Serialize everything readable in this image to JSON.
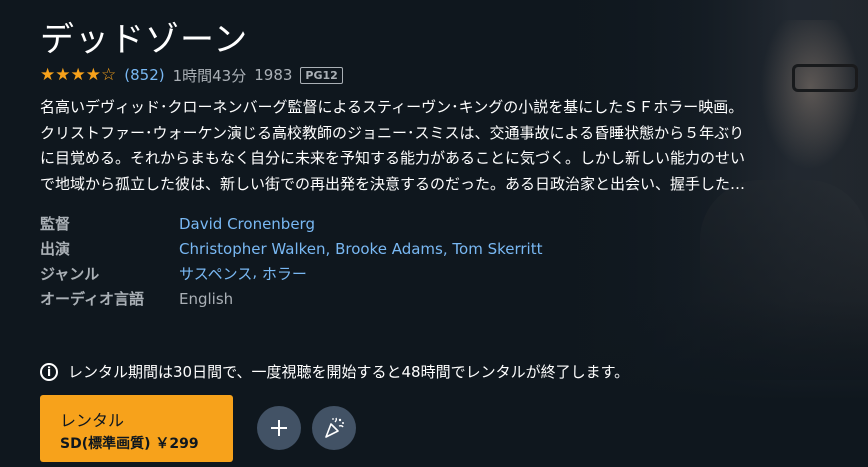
{
  "title": "デッドゾーン",
  "meta": {
    "rating_stars": 4,
    "rating_max": 5,
    "rating_count": "(852)",
    "duration": "1時間43分",
    "year": "1983",
    "badge": "PG12"
  },
  "synopsis_lines": [
    "名高いデヴィッド･クローネンバーグ監督によるスティーヴン･キングの小説を基にしたＳＦホラー映画。",
    "クリストファー･ウォーケン演じる高校教師のジョニー･スミスは、交通事故による昏睡状態から５年ぶり",
    "に目覚める。それからまもなく自分に未来を予知する能力があることに気づく。しかし新しい能力のせい",
    "で地域から孤立した彼は、新しい街での再出発を決意するのだった。ある日政治家と出会い、握手した…"
  ],
  "details": {
    "director_label": "監督",
    "director": "David Cronenberg",
    "cast_label": "出演",
    "cast": [
      "Christopher Walken",
      "Brooke Adams",
      "Tom Skerritt"
    ],
    "genre_label": "ジャンル",
    "genres": [
      "サスペンス",
      "ホラー"
    ],
    "audio_label": "オーディオ言語",
    "audio": "English",
    "separator": ","
  },
  "notice": {
    "icon": "i",
    "text": "レンタル期間は30日間で、一度視聴を開始すると48時間でレンタルが終了します。"
  },
  "rent_button": {
    "label": "レンタル",
    "price": "SD(標準画質) ￥299"
  },
  "buttons": {
    "add_icon": "plus-icon",
    "party_icon": "watch-party-icon"
  },
  "colors": {
    "background": "#0f171e",
    "accent": "#f7a21b",
    "link": "#79b8f3",
    "circle_button": "#425265"
  }
}
